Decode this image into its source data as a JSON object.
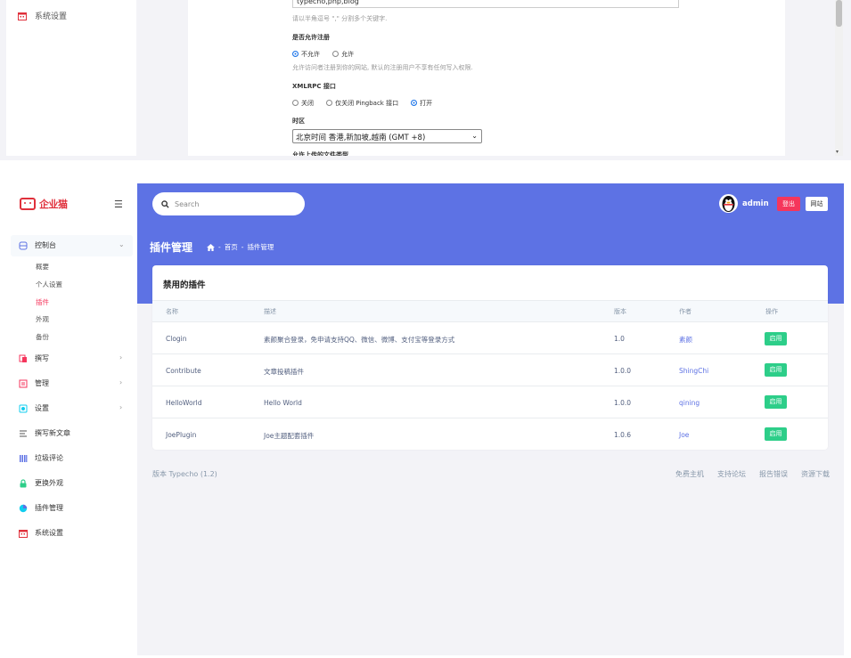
{
  "top": {
    "sidebar_item": "系统设置",
    "input_value": "typecho,php,blog",
    "keyword_hint": "请以半角逗号 \",\" 分割多个关键字.",
    "register_label": "是否允许注册",
    "register_options": [
      "不允许",
      "允许"
    ],
    "register_hint": "允许访问者注册到你的网站, 默认的注册用户不享有任何写入权限.",
    "xmlrpc_label": "XMLRPC 接口",
    "xmlrpc_options": [
      "关闭",
      "仅关闭 Pingback 接口",
      "打开"
    ],
    "timezone_label": "时区",
    "timezone_value": "北京时间 香港,新加坡,越南 (GMT +8)",
    "next_label": "允许上传的文件类型"
  },
  "header": {
    "logo_text": "企业猫",
    "search_placeholder": "Search",
    "user_name": "admin",
    "logout_label": "登出",
    "site_label": "网站"
  },
  "sidebar": {
    "dashboard": "控制台",
    "dashboard_sub": [
      "概要",
      "个人设置",
      "插件",
      "外观",
      "备份"
    ],
    "write": "撰写",
    "manage": "管理",
    "settings": "设置",
    "new_post": "撰写新文章",
    "spam": "垃圾评论",
    "theme": "更换外观",
    "plugins": "插件管理",
    "system": "系统设置"
  },
  "page": {
    "title": "插件管理",
    "breadcrumb_home": "首页",
    "breadcrumb_current": "插件管理"
  },
  "card": {
    "title": "禁用的插件",
    "columns": [
      "名称",
      "描述",
      "版本",
      "作者",
      "操作"
    ],
    "rows": [
      {
        "name": "Clogin",
        "desc": "素颜聚合登录，免申请支持QQ、微信、微博、支付宝等登录方式",
        "version": "1.0",
        "author": "素颜",
        "action": "启用"
      },
      {
        "name": "Contribute",
        "desc": "文章投稿插件",
        "version": "1.0.0",
        "author": "ShingChi",
        "action": "启用"
      },
      {
        "name": "HelloWorld",
        "desc": "Hello World",
        "version": "1.0.0",
        "author": "qining",
        "action": "启用"
      },
      {
        "name": "JoePlugin",
        "desc": "Joe主题配套插件",
        "version": "1.0.6",
        "author": "Joe",
        "action": "启用"
      }
    ]
  },
  "footer": {
    "version": "版本 Typecho (1.2)",
    "links": [
      "免费主机",
      "支持论坛",
      "报告错误",
      "资源下载"
    ]
  },
  "colors": {
    "accent": "#5d72e4",
    "danger": "#f5365c",
    "success": "#2dce89"
  }
}
